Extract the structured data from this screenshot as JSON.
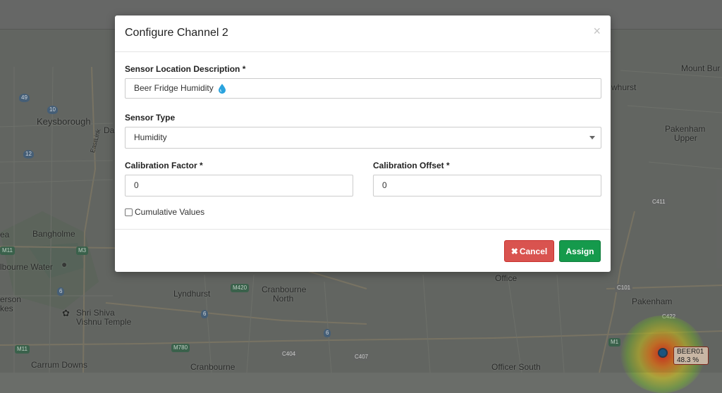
{
  "modal": {
    "title": "Configure Channel 2",
    "close_glyph": "×",
    "location": {
      "label": "Sensor Location Description *",
      "value": "Beer Fridge Humidity",
      "icon": "water-drop-icon"
    },
    "sensor_type": {
      "label": "Sensor Type",
      "selected": "Humidity"
    },
    "calibration_factor": {
      "label": "Calibration Factor *",
      "value": "0"
    },
    "calibration_offset": {
      "label": "Calibration Offset *",
      "value": "0"
    },
    "cumulative": {
      "label": "Cumulative Values",
      "checked": false
    },
    "buttons": {
      "cancel": "Cancel",
      "assign": "Assign"
    }
  },
  "map": {
    "places": {
      "keysborough": "Keysborough",
      "bangholme": "Bangholme",
      "melbourne_water": "lbourne Water",
      "lyndhurst": "Lyndhurst",
      "cranbourne_north": "Cranbourne",
      "cranbourne_north2": "North",
      "shri_shiva": "Shri Shiva",
      "vishnu_temple": "Vishnu Temple",
      "carrum_downs": "Carrum Downs",
      "cranbourne": "Cranbourne",
      "officer_south": "Officer South",
      "pakenham": "Pakenham",
      "pakenham_upper": "Pakenham",
      "pakenham_upper2": "Upper",
      "mount_burnett": "Mount Bur",
      "nwhurst": "whurst",
      "ea": "ea",
      "erson": "erson",
      "kes": "kes",
      "dan": "Dan",
      "eastlink": "EastLink",
      "officer": "Office"
    },
    "roads": {
      "r49": "49",
      "r10": "10",
      "r12": "12",
      "m11a": "M11",
      "m3": "M3",
      "r6a": "6",
      "m11b": "M11",
      "m420": "M420",
      "r6b": "6",
      "r6c": "6",
      "m780": "M780",
      "c404": "C404",
      "c407": "C407",
      "c411": "C411",
      "c101": "C101",
      "c422": "C422",
      "m1": "M1"
    },
    "sensor_badge": {
      "name": "BEER01",
      "reading": "48.3 %"
    }
  }
}
